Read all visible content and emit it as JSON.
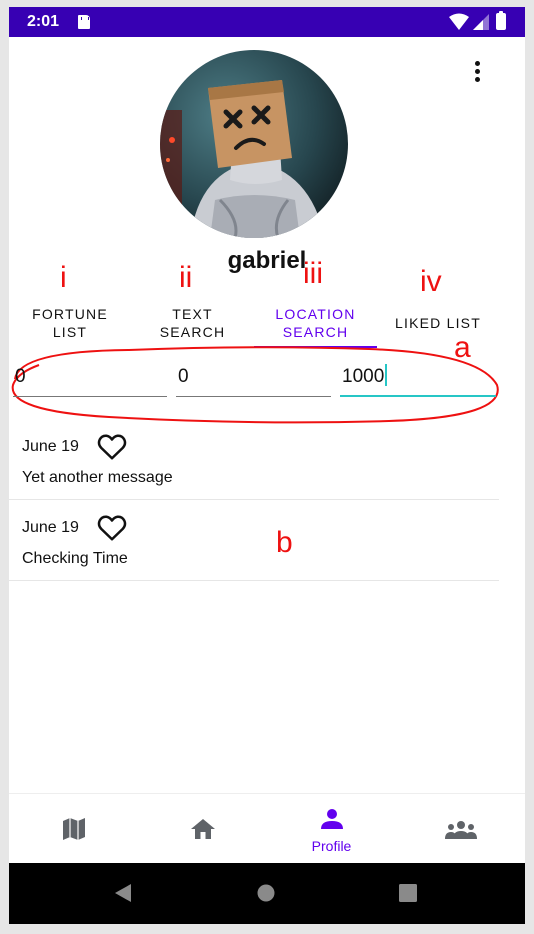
{
  "status_bar": {
    "time": "2:01"
  },
  "profile": {
    "username": "gabriel"
  },
  "annotations": {
    "tab_markers": [
      "i",
      "ii",
      "iii",
      "iv"
    ],
    "fields_marker": "a",
    "list_marker": "b"
  },
  "tabs": [
    {
      "line1": "FORTUNE",
      "line2": "LIST",
      "active": false
    },
    {
      "line1": "TEXT",
      "line2": "SEARCH",
      "active": false
    },
    {
      "line1": "LOCATION",
      "line2": "SEARCH",
      "active": true
    },
    {
      "line1": "LIKED LIST",
      "line2": "",
      "active": false
    }
  ],
  "search_fields": [
    {
      "value": "0"
    },
    {
      "value": "0"
    },
    {
      "value": "1000",
      "focused": true
    }
  ],
  "messages": [
    {
      "date": "June 19",
      "text": "Yet another message",
      "liked": false
    },
    {
      "date": "June 19",
      "text": "Checking Time",
      "liked": false
    }
  ],
  "bottom_nav": {
    "items": [
      {
        "icon": "map-icon",
        "label": ""
      },
      {
        "icon": "home-icon",
        "label": ""
      },
      {
        "icon": "person-icon",
        "label": "Profile",
        "active": true
      },
      {
        "icon": "group-icon",
        "label": ""
      }
    ]
  },
  "colors": {
    "status_bar": "#3700b3",
    "accent": "#6200ee",
    "focus_underline": "#26c6c6",
    "annotation": "#ee1111"
  }
}
